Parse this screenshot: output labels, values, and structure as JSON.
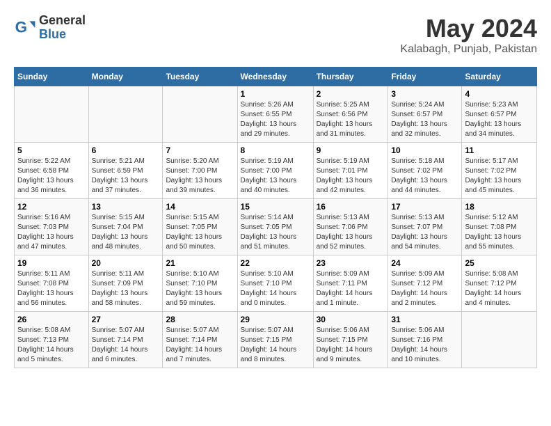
{
  "header": {
    "logo_general": "General",
    "logo_blue": "Blue",
    "title": "May 2024",
    "subtitle": "Kalabagh, Punjab, Pakistan"
  },
  "days_of_week": [
    "Sunday",
    "Monday",
    "Tuesday",
    "Wednesday",
    "Thursday",
    "Friday",
    "Saturday"
  ],
  "weeks": [
    [
      {
        "day": "",
        "info": ""
      },
      {
        "day": "",
        "info": ""
      },
      {
        "day": "",
        "info": ""
      },
      {
        "day": "1",
        "info": "Sunrise: 5:26 AM\nSunset: 6:55 PM\nDaylight: 13 hours\nand 29 minutes."
      },
      {
        "day": "2",
        "info": "Sunrise: 5:25 AM\nSunset: 6:56 PM\nDaylight: 13 hours\nand 31 minutes."
      },
      {
        "day": "3",
        "info": "Sunrise: 5:24 AM\nSunset: 6:57 PM\nDaylight: 13 hours\nand 32 minutes."
      },
      {
        "day": "4",
        "info": "Sunrise: 5:23 AM\nSunset: 6:57 PM\nDaylight: 13 hours\nand 34 minutes."
      }
    ],
    [
      {
        "day": "5",
        "info": "Sunrise: 5:22 AM\nSunset: 6:58 PM\nDaylight: 13 hours\nand 36 minutes."
      },
      {
        "day": "6",
        "info": "Sunrise: 5:21 AM\nSunset: 6:59 PM\nDaylight: 13 hours\nand 37 minutes."
      },
      {
        "day": "7",
        "info": "Sunrise: 5:20 AM\nSunset: 7:00 PM\nDaylight: 13 hours\nand 39 minutes."
      },
      {
        "day": "8",
        "info": "Sunrise: 5:19 AM\nSunset: 7:00 PM\nDaylight: 13 hours\nand 40 minutes."
      },
      {
        "day": "9",
        "info": "Sunrise: 5:19 AM\nSunset: 7:01 PM\nDaylight: 13 hours\nand 42 minutes."
      },
      {
        "day": "10",
        "info": "Sunrise: 5:18 AM\nSunset: 7:02 PM\nDaylight: 13 hours\nand 44 minutes."
      },
      {
        "day": "11",
        "info": "Sunrise: 5:17 AM\nSunset: 7:02 PM\nDaylight: 13 hours\nand 45 minutes."
      }
    ],
    [
      {
        "day": "12",
        "info": "Sunrise: 5:16 AM\nSunset: 7:03 PM\nDaylight: 13 hours\nand 47 minutes."
      },
      {
        "day": "13",
        "info": "Sunrise: 5:15 AM\nSunset: 7:04 PM\nDaylight: 13 hours\nand 48 minutes."
      },
      {
        "day": "14",
        "info": "Sunrise: 5:15 AM\nSunset: 7:05 PM\nDaylight: 13 hours\nand 50 minutes."
      },
      {
        "day": "15",
        "info": "Sunrise: 5:14 AM\nSunset: 7:05 PM\nDaylight: 13 hours\nand 51 minutes."
      },
      {
        "day": "16",
        "info": "Sunrise: 5:13 AM\nSunset: 7:06 PM\nDaylight: 13 hours\nand 52 minutes."
      },
      {
        "day": "17",
        "info": "Sunrise: 5:13 AM\nSunset: 7:07 PM\nDaylight: 13 hours\nand 54 minutes."
      },
      {
        "day": "18",
        "info": "Sunrise: 5:12 AM\nSunset: 7:08 PM\nDaylight: 13 hours\nand 55 minutes."
      }
    ],
    [
      {
        "day": "19",
        "info": "Sunrise: 5:11 AM\nSunset: 7:08 PM\nDaylight: 13 hours\nand 56 minutes."
      },
      {
        "day": "20",
        "info": "Sunrise: 5:11 AM\nSunset: 7:09 PM\nDaylight: 13 hours\nand 58 minutes."
      },
      {
        "day": "21",
        "info": "Sunrise: 5:10 AM\nSunset: 7:10 PM\nDaylight: 13 hours\nand 59 minutes."
      },
      {
        "day": "22",
        "info": "Sunrise: 5:10 AM\nSunset: 7:10 PM\nDaylight: 14 hours\nand 0 minutes."
      },
      {
        "day": "23",
        "info": "Sunrise: 5:09 AM\nSunset: 7:11 PM\nDaylight: 14 hours\nand 1 minute."
      },
      {
        "day": "24",
        "info": "Sunrise: 5:09 AM\nSunset: 7:12 PM\nDaylight: 14 hours\nand 2 minutes."
      },
      {
        "day": "25",
        "info": "Sunrise: 5:08 AM\nSunset: 7:12 PM\nDaylight: 14 hours\nand 4 minutes."
      }
    ],
    [
      {
        "day": "26",
        "info": "Sunrise: 5:08 AM\nSunset: 7:13 PM\nDaylight: 14 hours\nand 5 minutes."
      },
      {
        "day": "27",
        "info": "Sunrise: 5:07 AM\nSunset: 7:14 PM\nDaylight: 14 hours\nand 6 minutes."
      },
      {
        "day": "28",
        "info": "Sunrise: 5:07 AM\nSunset: 7:14 PM\nDaylight: 14 hours\nand 7 minutes."
      },
      {
        "day": "29",
        "info": "Sunrise: 5:07 AM\nSunset: 7:15 PM\nDaylight: 14 hours\nand 8 minutes."
      },
      {
        "day": "30",
        "info": "Sunrise: 5:06 AM\nSunset: 7:15 PM\nDaylight: 14 hours\nand 9 minutes."
      },
      {
        "day": "31",
        "info": "Sunrise: 5:06 AM\nSunset: 7:16 PM\nDaylight: 14 hours\nand 10 minutes."
      },
      {
        "day": "",
        "info": ""
      }
    ]
  ]
}
